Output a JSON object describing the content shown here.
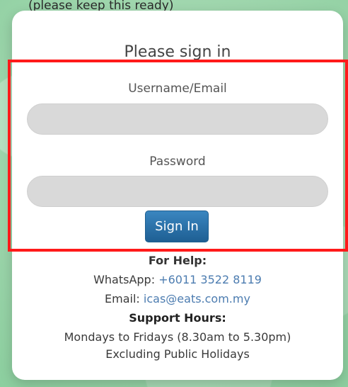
{
  "top_partial_text": "(please keep this ready)",
  "card": {
    "title": "Please sign in",
    "username_label": "Username/Email",
    "username_value": "",
    "password_label": "Password",
    "password_value": "",
    "signin_label": "Sign In"
  },
  "help": {
    "heading": "For Help:",
    "whatsapp_prefix": "WhatsApp: ",
    "whatsapp_number": "+6011 3522 8119",
    "email_prefix": "Email: ",
    "email_address": "icas@eats.com.my",
    "support_heading": "Support Hours:",
    "support_hours": "Mondays to Fridays (8.30am to 5.30pm)",
    "support_note": "Excluding Public Holidays"
  },
  "colors": {
    "accent_button": "#1e5f93",
    "link": "#4c7cb0",
    "highlight_box": "#ff1a1a",
    "background": "#9fd6ad"
  }
}
